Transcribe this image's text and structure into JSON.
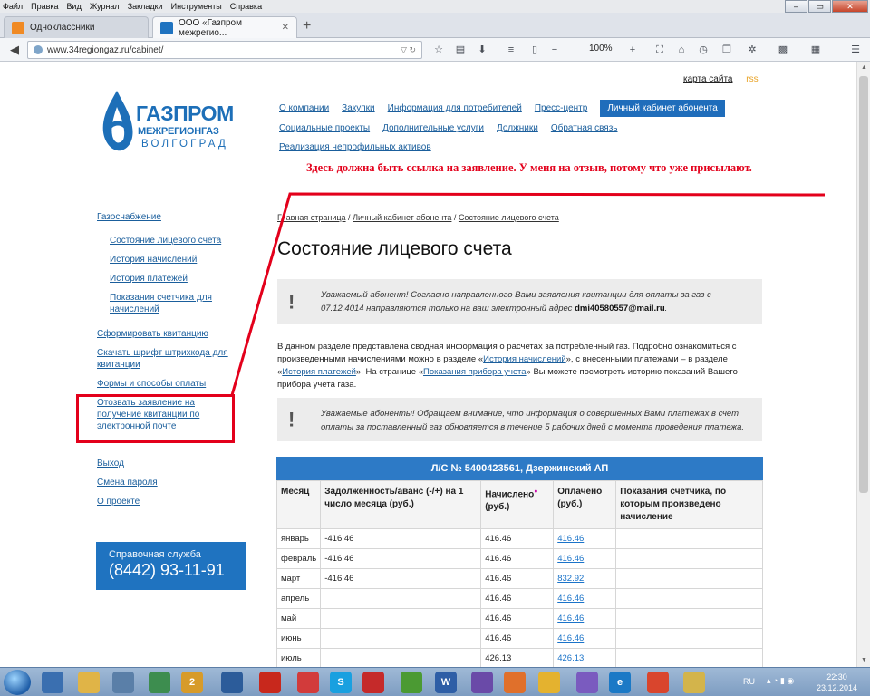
{
  "menubar": [
    "Файл",
    "Правка",
    "Вид",
    "Журнал",
    "Закладки",
    "Инструменты",
    "Справка"
  ],
  "tabs": [
    {
      "title": "Одноклассники",
      "color": "#f08a24"
    },
    {
      "title": "ООО «Газпром межрегио...",
      "color": "#1f73c0"
    }
  ],
  "address": {
    "url": "www.34regiongaz.ru/cabinet/",
    "zoom": "100%"
  },
  "top_links": {
    "sitemap": "карта сайта",
    "rss": "rss"
  },
  "logo": {
    "line1": "ГАЗПРОМ",
    "line2": "МЕЖРЕГИОНГАЗ",
    "line3": "ВОЛГОГРАД"
  },
  "nav": {
    "row1": [
      "О компании",
      "Закупки",
      "Информация для потребителей",
      "Пресс-центр"
    ],
    "active": "Личный кабинет абонента",
    "row2": [
      "Социальные проекты",
      "Дополнительные услуги",
      "Должники",
      "Обратная связь"
    ],
    "row3": [
      "Реализация непрофильных активов"
    ]
  },
  "annotation": "Здесь должна быть ссылка на заявление. У меня на отзыв, потому что уже присылают.",
  "sidebar": {
    "section": "Газоснабжение",
    "sub": [
      "Состояние лицевого счета",
      "История начислений",
      "История платежей",
      "Показания счетчика для начислений"
    ],
    "links": [
      "Сформировать квитанцию",
      "Скачать шрифт штрихкода для квитанции",
      "Формы и способы оплаты",
      "Отозвать заявление на получение квитанции по электронной почте"
    ],
    "account": [
      "Выход",
      "Смена пароля",
      "О проекте"
    ]
  },
  "help": {
    "label": "Справочная служба",
    "phone": "(8442) 93-11-91"
  },
  "breadcrumb": [
    "Главная страница",
    "Личный кабинет абонента",
    "Состояние лицевого счета"
  ],
  "title": "Состояние лицевого счета",
  "notice1": {
    "text": "Уважаемый абонент! Согласно направленного Вами заявления квитанции для оплаты за газ с 07.12.4014 направляются только на ваш электронный адрес",
    "email": "dmi40580557@mail.ru",
    "end": "."
  },
  "intro": {
    "p1": "В данном разделе представлена сводная информация о расчетах за потребленный газ. Подробно ознакомиться с произведенными начислениями можно в разделе «",
    "l1": "История начислений",
    "p2": "», с внесенными платежами – в разделе «",
    "l2": "История платежей",
    "p3": "». На странице «",
    "l3": "Показания прибора учета",
    "p4": "» Вы можете посмотреть историю показаний Вашего прибора учета газа."
  },
  "notice2": {
    "text": "Уважаемые абоненты! Обращаем внимание, что информация о совершенных Вами платежах в счет оплаты за поставленный газ обновляется в течение 5 рабочих дней с момента проведения платежа."
  },
  "table": {
    "caption": "Л/С № 5400423561, Дзержинский АП",
    "headers": [
      "Месяц",
      "Задолженность/аванс (-/+) на 1 число месяца (руб.)",
      "Начислено",
      "(руб.)",
      "Оплачено (руб.)",
      "Показания счетчика, по которым произведено начисление"
    ],
    "rows": [
      {
        "month": "январь",
        "debt": "-416.46",
        "charged": "416.46",
        "paid": "416.46",
        "meter": ""
      },
      {
        "month": "февраль",
        "debt": "-416.46",
        "charged": "416.46",
        "paid": "416.46",
        "meter": ""
      },
      {
        "month": "март",
        "debt": "-416.46",
        "charged": "416.46",
        "paid": "832.92",
        "meter": ""
      },
      {
        "month": "апрель",
        "debt": "",
        "charged": "416.46",
        "paid": "416.46",
        "meter": ""
      },
      {
        "month": "май",
        "debt": "",
        "charged": "416.46",
        "paid": "416.46",
        "meter": ""
      },
      {
        "month": "июнь",
        "debt": "",
        "charged": "416.46",
        "paid": "416.46",
        "meter": ""
      },
      {
        "month": "июль",
        "debt": "",
        "charged": "426.13",
        "paid": "426.13",
        "meter": ""
      }
    ]
  },
  "taskbar": {
    "lang": "RU",
    "time": "22:30",
    "date": "23.12.2014",
    "apps": [
      {
        "name": "explorer",
        "color": "#3a6fb0",
        "label": ""
      },
      {
        "name": "folder",
        "color": "#e0b447",
        "label": ""
      },
      {
        "name": "calc",
        "color": "#5a7fa8",
        "label": ""
      },
      {
        "name": "chrome",
        "color": "#3d8d4f",
        "label": ""
      },
      {
        "name": "icq",
        "color": "#d79b2a",
        "label": "2"
      },
      {
        "name": "mail",
        "color": "#2c5c9a",
        "label": ""
      },
      {
        "name": "pdf",
        "color": "#c8281c",
        "label": ""
      },
      {
        "name": "chat",
        "color": "#d23b3b",
        "label": ""
      },
      {
        "name": "skype",
        "color": "#19a0e0",
        "label": "S"
      },
      {
        "name": "app",
        "color": "#c52a2a",
        "label": ""
      },
      {
        "name": "winamp",
        "color": "#4b9a33",
        "label": ""
      },
      {
        "name": "word",
        "color": "#2e5ea6",
        "label": "W"
      },
      {
        "name": "vs",
        "color": "#6a4aa8",
        "label": ""
      },
      {
        "name": "firefox",
        "color": "#e0702b",
        "label": ""
      },
      {
        "name": "daemon",
        "color": "#e4b22f",
        "label": ""
      },
      {
        "name": "vs2",
        "color": "#7a5bbf",
        "label": ""
      },
      {
        "name": "ie",
        "color": "#1b79c6",
        "label": "e"
      },
      {
        "name": "ccleaner",
        "color": "#d9452d",
        "label": ""
      },
      {
        "name": "lang-app",
        "color": "#d3b44b",
        "label": ""
      }
    ]
  }
}
